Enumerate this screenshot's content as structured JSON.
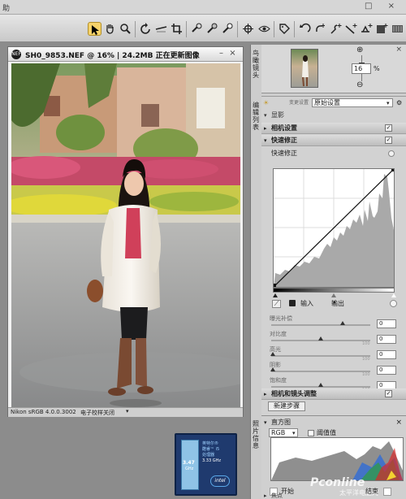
{
  "menubar": {
    "label": "助",
    "window_buttons": "□ ×"
  },
  "toolbar": {
    "icons": [
      "direct-select-icon",
      "hand-icon",
      "zoom-icon",
      "rotate-icon",
      "straighten-icon",
      "crop-icon",
      "red-eye-icon",
      "color-picker-icon",
      "white-point-icon",
      "control-point-icon",
      "auto-retouch-icon",
      "selection-brush-icon",
      "lasso-icon",
      "sun-icon",
      "eye-icon",
      "tag-icon",
      "undo-icon",
      "rotate-plus-icon",
      "color-plus-icon",
      "line-plus-icon",
      "balance-plus-icon",
      "grid-icon",
      "grid-plus-icon",
      "filmstrip-icon"
    ]
  },
  "image_window": {
    "badge": "NEF",
    "title": "SH0_9853.NEF @ 16% | 24.2MB 正在更新图像",
    "status_profile": "Nikon sRGB 4.0.0.3002",
    "status_proof": "电子校样关闭",
    "colors": {
      "titlebar": "#e8e8e8",
      "frame": "#f2f2f2"
    }
  },
  "birdseye": {
    "tab_label": "鸟瞰镜头",
    "zoom_value": "16",
    "zoom_unit": "%"
  },
  "adjust": {
    "tab_label": "编辑列表",
    "settings_label": "变更设置",
    "settings_value": "原始设置",
    "develop_label": "显影",
    "camera_settings": "相机设置",
    "quick_fix": "快速修正",
    "quick_fix_sub": "快速修正",
    "input_label": "输入",
    "output_label": "输出",
    "sliders": [
      {
        "label": "曝光补偿",
        "value": "0",
        "scale": "",
        "pos": 0.72
      },
      {
        "label": "对比度",
        "value": "0",
        "scale": "100",
        "pos": 0.5
      },
      {
        "label": "高光",
        "value": "0",
        "scale": "100",
        "pos": 0.02
      },
      {
        "label": "阴影",
        "value": "0",
        "scale": "100",
        "pos": 0.02
      },
      {
        "label": "饱和度",
        "value": "0",
        "scale": "100",
        "pos": 0.5
      }
    ],
    "lens_correction": "相机和镜头调整",
    "new_step": "新建步骤"
  },
  "histogram": {
    "tab_label": "照片信息",
    "title": "直方图",
    "channel": "RGB",
    "threshold_label": "阈值值",
    "start_label": "开始",
    "end_label": "结束",
    "focus_label": "焦点",
    "watermark": "Pconline",
    "watermark_sub": "太平洋电脑网"
  },
  "cpu_badge": {
    "title_lines": [
      "英特尔®",
      "酷睿™ i5",
      "处理器"
    ],
    "number": "3.47",
    "ghz": "GHz",
    "speed": "3.33 GHz",
    "brand": "intel"
  }
}
